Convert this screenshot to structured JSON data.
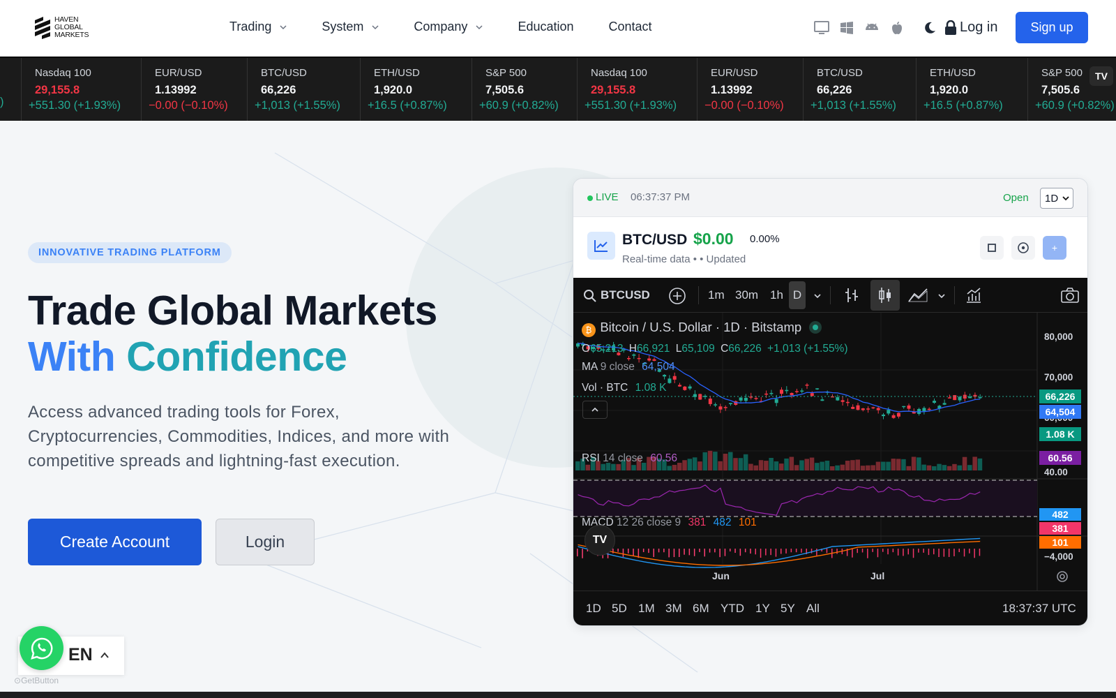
{
  "brand": {
    "line1": "HAVEN",
    "line2": "GLOBAL",
    "line3": "MARKETS"
  },
  "nav": {
    "items": [
      {
        "label": "Trading",
        "dropdown": true
      },
      {
        "label": "System",
        "dropdown": true
      },
      {
        "label": "Company",
        "dropdown": true
      },
      {
        "label": "Education",
        "dropdown": false
      },
      {
        "label": "Contact",
        "dropdown": false
      }
    ],
    "platform_icons": [
      "desktop-icon",
      "windows-icon",
      "android-icon",
      "apple-icon"
    ],
    "theme_icon": "moon-icon",
    "login_label": "Log in",
    "signup_label": "Sign up"
  },
  "ticker": {
    "items": [
      {
        "symbol": "",
        "price": "",
        "change": ")",
        "dir": "up",
        "price_red": false
      },
      {
        "symbol": "Nasdaq 100",
        "price": "29,155.8",
        "change": "+551.30 (+1.93%)",
        "dir": "up",
        "price_red": true
      },
      {
        "symbol": "EUR/USD",
        "price": "1.13992",
        "change": "−0.00 (−0.10%)",
        "dir": "dn",
        "price_red": false
      },
      {
        "symbol": "BTC/USD",
        "price": "66,226",
        "change": "+1,013 (+1.55%)",
        "dir": "up",
        "price_red": false
      },
      {
        "symbol": "ETH/USD",
        "price": "1,920.0",
        "change": "+16.5 (+0.87%)",
        "dir": "up",
        "price_red": false
      },
      {
        "symbol": "S&P 500",
        "price": "7,505.6",
        "change": "+60.9 (+0.82%)",
        "dir": "up",
        "price_red": false
      },
      {
        "symbol": "Nasdaq 100",
        "price": "29,155.8",
        "change": "+551.30 (+1.93%)",
        "dir": "up",
        "price_red": true
      },
      {
        "symbol": "EUR/USD",
        "price": "1.13992",
        "change": "−0.00 (−0.10%)",
        "dir": "dn",
        "price_red": false
      },
      {
        "symbol": "BTC/USD",
        "price": "66,226",
        "change": "+1,013 (+1.55%)",
        "dir": "up",
        "price_red": false
      },
      {
        "symbol": "ETH/USD",
        "price": "1,920.0",
        "change": "+16.5 (+0.87%)",
        "dir": "up",
        "price_red": false
      },
      {
        "symbol": "S&P 500",
        "price": "7,505.6",
        "change": "+60.9 (+0.82%)",
        "dir": "up",
        "price_red": false
      }
    ],
    "badge": "TV"
  },
  "hero": {
    "badge": "INNOVATIVE TRADING PLATFORM",
    "title_line1": "Trade Global Markets",
    "title_word1": "With",
    "title_word2": "Confidence",
    "subtitle": "Access advanced trading tools for Forex, Cryptocurrencies, Commodities, Indices, and more with competitive spreads and lightning-fast execution.",
    "create_label": "Create Account",
    "login_label": "Login"
  },
  "widget": {
    "live_label": "LIVE",
    "time": "06:37:37 PM",
    "status": "Open",
    "timeframe": "1D",
    "pair": "BTC/USD",
    "price": "$0.00",
    "pct": "0.00%",
    "subtext": "Real-time data •  • Updated"
  },
  "tv": {
    "symbol": "BTCUSD",
    "intervals": [
      "1m",
      "30m",
      "1h",
      "D"
    ],
    "title": "Bitcoin / U.S. Dollar · 1D · Bitstamp",
    "ohlc": {
      "o_label": "O",
      "o": "65,213",
      "h_label": "H",
      "h": "66,921",
      "l_label": "L",
      "l": "65,109",
      "c_label": "C",
      "c": "66,226",
      "chg": "+1,013 (+1.55%)"
    },
    "ma": {
      "label": "MA",
      "params": "9 close",
      "value": "64,504"
    },
    "vol": {
      "label": "Vol · BTC",
      "value": "1.08 K"
    },
    "rsi": {
      "label": "RSI",
      "params": "14 close",
      "value": "60.56"
    },
    "macd": {
      "label": "MACD",
      "params": "12 26 close 9",
      "v1": "381",
      "v2": "482",
      "v3": "101"
    },
    "axis": {
      "y1": "80,000",
      "y2": "70,000",
      "y3": "60,000",
      "rsi40": "40.00",
      "macd_low": "−4,000"
    },
    "tags": {
      "close": "66,226",
      "ma": "64,504",
      "vol": "1.08 K",
      "rsi": "60.56",
      "macd1": "482",
      "macd2": "381",
      "macd3": "101"
    },
    "x_labels": [
      "Jun",
      "Jul"
    ],
    "ranges": [
      "1D",
      "5D",
      "1M",
      "3M",
      "6M",
      "YTD",
      "1Y",
      "5Y",
      "All"
    ],
    "utc": "18:37:37 UTC",
    "colors": {
      "up": "#22ab94",
      "down": "#f23645",
      "ma": "#2962ff",
      "rsi": "#9c27b0",
      "macd": "#2196f3",
      "signal": "#ff6d00"
    }
  },
  "language": {
    "code": "EN"
  },
  "getbutton": "GetButton"
}
